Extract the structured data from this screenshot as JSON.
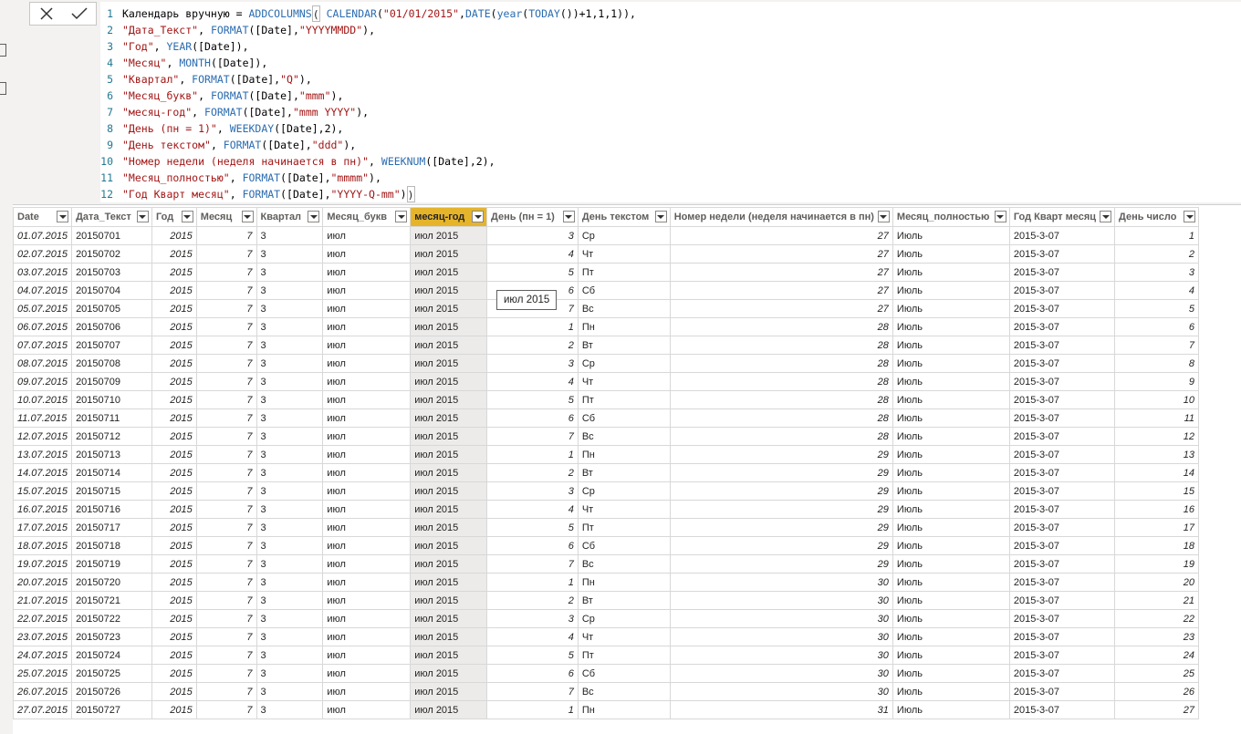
{
  "formula": {
    "lines": [
      [
        {
          "t": "Календарь вручную = ",
          "c": "plain"
        },
        {
          "t": "ADDCOLUMNS",
          "c": "fn"
        },
        {
          "t": "(",
          "c": "br"
        },
        {
          "t": " CALENDAR",
          "c": "fn"
        },
        {
          "t": "(",
          "c": "plain"
        },
        {
          "t": "\"01/01/2015\"",
          "c": "str"
        },
        {
          "t": ",",
          "c": "plain"
        },
        {
          "t": "DATE",
          "c": "fn"
        },
        {
          "t": "(",
          "c": "plain"
        },
        {
          "t": "year",
          "c": "fn"
        },
        {
          "t": "(",
          "c": "plain"
        },
        {
          "t": "TODAY",
          "c": "fn"
        },
        {
          "t": "())+1,1,1)),",
          "c": "plain"
        }
      ],
      [
        {
          "t": "\"Дата_Текст\"",
          "c": "str"
        },
        {
          "t": ", ",
          "c": "plain"
        },
        {
          "t": "FORMAT",
          "c": "fn"
        },
        {
          "t": "([Date],",
          "c": "plain"
        },
        {
          "t": "\"YYYYMMDD\"",
          "c": "str"
        },
        {
          "t": "),",
          "c": "plain"
        }
      ],
      [
        {
          "t": "\"Год\"",
          "c": "str"
        },
        {
          "t": ", ",
          "c": "plain"
        },
        {
          "t": "YEAR",
          "c": "fn"
        },
        {
          "t": "([Date]),",
          "c": "plain"
        }
      ],
      [
        {
          "t": "\"Месяц\"",
          "c": "str"
        },
        {
          "t": ", ",
          "c": "plain"
        },
        {
          "t": "MONTH",
          "c": "fn"
        },
        {
          "t": "([Date]),",
          "c": "plain"
        }
      ],
      [
        {
          "t": "\"Квартал\"",
          "c": "str"
        },
        {
          "t": ", ",
          "c": "plain"
        },
        {
          "t": "FORMAT",
          "c": "fn"
        },
        {
          "t": "([Date],",
          "c": "plain"
        },
        {
          "t": "\"Q\"",
          "c": "str"
        },
        {
          "t": "),",
          "c": "plain"
        }
      ],
      [
        {
          "t": "\"Месяц_букв\"",
          "c": "str"
        },
        {
          "t": ", ",
          "c": "plain"
        },
        {
          "t": "FORMAT",
          "c": "fn"
        },
        {
          "t": "([Date],",
          "c": "plain"
        },
        {
          "t": "\"mmm\"",
          "c": "str"
        },
        {
          "t": "),",
          "c": "plain"
        }
      ],
      [
        {
          "t": "\"месяц-год\"",
          "c": "str"
        },
        {
          "t": ", ",
          "c": "plain"
        },
        {
          "t": "FORMAT",
          "c": "fn"
        },
        {
          "t": "([Date],",
          "c": "plain"
        },
        {
          "t": "\"mmm YYYY\"",
          "c": "str"
        },
        {
          "t": "),",
          "c": "plain"
        }
      ],
      [
        {
          "t": "\"День (пн = 1)\"",
          "c": "str"
        },
        {
          "t": ", ",
          "c": "plain"
        },
        {
          "t": "WEEKDAY",
          "c": "fn"
        },
        {
          "t": "([Date],2),",
          "c": "plain"
        }
      ],
      [
        {
          "t": "\"День текстом\"",
          "c": "str"
        },
        {
          "t": ", ",
          "c": "plain"
        },
        {
          "t": "FORMAT",
          "c": "fn"
        },
        {
          "t": "([Date],",
          "c": "plain"
        },
        {
          "t": "\"ddd\"",
          "c": "str"
        },
        {
          "t": "),",
          "c": "plain"
        }
      ],
      [
        {
          "t": "\"Номер недели (неделя начинается в пн)\"",
          "c": "str"
        },
        {
          "t": ", ",
          "c": "plain"
        },
        {
          "t": "WEEKNUM",
          "c": "fn"
        },
        {
          "t": "([Date],2),",
          "c": "plain"
        }
      ],
      [
        {
          "t": "\"Месяц_полностью\"",
          "c": "str"
        },
        {
          "t": ", ",
          "c": "plain"
        },
        {
          "t": "FORMAT",
          "c": "fn"
        },
        {
          "t": "([Date],",
          "c": "plain"
        },
        {
          "t": "\"mmmm\"",
          "c": "str"
        },
        {
          "t": "),",
          "c": "plain"
        }
      ],
      [
        {
          "t": "\"Год Кварт месяц\"",
          "c": "str"
        },
        {
          "t": ", ",
          "c": "plain"
        },
        {
          "t": "FORMAT",
          "c": "fn"
        },
        {
          "t": "([Date],",
          "c": "plain"
        },
        {
          "t": "\"YYYY-Q-mm\"",
          "c": "str"
        },
        {
          "t": ")",
          "c": "plain"
        },
        {
          "t": ")",
          "c": "br"
        }
      ]
    ]
  },
  "table": {
    "columns": [
      {
        "label": "Date",
        "align": "date"
      },
      {
        "label": "Дата_Текст",
        "align": "text"
      },
      {
        "label": "Год",
        "align": "num"
      },
      {
        "label": "Месяц",
        "align": "num"
      },
      {
        "label": "Квартал",
        "align": "text"
      },
      {
        "label": "Месяц_букв",
        "align": "text"
      },
      {
        "label": "месяц-год",
        "align": "text",
        "selected": true
      },
      {
        "label": "День (пн = 1)",
        "align": "num"
      },
      {
        "label": "День текстом",
        "align": "text"
      },
      {
        "label": "Номер недели (неделя начинается в пн)",
        "align": "num"
      },
      {
        "label": "Месяц_полностью",
        "align": "text"
      },
      {
        "label": "Год Кварт месяц",
        "align": "text"
      },
      {
        "label": "День число",
        "align": "num"
      }
    ],
    "rows": [
      [
        "01.07.2015",
        "20150701",
        "2015",
        "7",
        "3",
        "июл",
        "июл 2015",
        "3",
        "Ср",
        "27",
        "Июль",
        "2015-3-07",
        "1"
      ],
      [
        "02.07.2015",
        "20150702",
        "2015",
        "7",
        "3",
        "июл",
        "июл 2015",
        "4",
        "Чт",
        "27",
        "Июль",
        "2015-3-07",
        "2"
      ],
      [
        "03.07.2015",
        "20150703",
        "2015",
        "7",
        "3",
        "июл",
        "июл 2015",
        "5",
        "Пт",
        "27",
        "Июль",
        "2015-3-07",
        "3"
      ],
      [
        "04.07.2015",
        "20150704",
        "2015",
        "7",
        "3",
        "июл",
        "июл 2015",
        "6",
        "Сб",
        "27",
        "Июль",
        "2015-3-07",
        "4"
      ],
      [
        "05.07.2015",
        "20150705",
        "2015",
        "7",
        "3",
        "июл",
        "июл 2015",
        "7",
        "Вс",
        "27",
        "Июль",
        "2015-3-07",
        "5"
      ],
      [
        "06.07.2015",
        "20150706",
        "2015",
        "7",
        "3",
        "июл",
        "июл 2015",
        "1",
        "Пн",
        "28",
        "Июль",
        "2015-3-07",
        "6"
      ],
      [
        "07.07.2015",
        "20150707",
        "2015",
        "7",
        "3",
        "июл",
        "июл 2015",
        "2",
        "Вт",
        "28",
        "Июль",
        "2015-3-07",
        "7"
      ],
      [
        "08.07.2015",
        "20150708",
        "2015",
        "7",
        "3",
        "июл",
        "июл 2015",
        "3",
        "Ср",
        "28",
        "Июль",
        "2015-3-07",
        "8"
      ],
      [
        "09.07.2015",
        "20150709",
        "2015",
        "7",
        "3",
        "июл",
        "июл 2015",
        "4",
        "Чт",
        "28",
        "Июль",
        "2015-3-07",
        "9"
      ],
      [
        "10.07.2015",
        "20150710",
        "2015",
        "7",
        "3",
        "июл",
        "июл 2015",
        "5",
        "Пт",
        "28",
        "Июль",
        "2015-3-07",
        "10"
      ],
      [
        "11.07.2015",
        "20150711",
        "2015",
        "7",
        "3",
        "июл",
        "июл 2015",
        "6",
        "Сб",
        "28",
        "Июль",
        "2015-3-07",
        "11"
      ],
      [
        "12.07.2015",
        "20150712",
        "2015",
        "7",
        "3",
        "июл",
        "июл 2015",
        "7",
        "Вс",
        "28",
        "Июль",
        "2015-3-07",
        "12"
      ],
      [
        "13.07.2015",
        "20150713",
        "2015",
        "7",
        "3",
        "июл",
        "июл 2015",
        "1",
        "Пн",
        "29",
        "Июль",
        "2015-3-07",
        "13"
      ],
      [
        "14.07.2015",
        "20150714",
        "2015",
        "7",
        "3",
        "июл",
        "июл 2015",
        "2",
        "Вт",
        "29",
        "Июль",
        "2015-3-07",
        "14"
      ],
      [
        "15.07.2015",
        "20150715",
        "2015",
        "7",
        "3",
        "июл",
        "июл 2015",
        "3",
        "Ср",
        "29",
        "Июль",
        "2015-3-07",
        "15"
      ],
      [
        "16.07.2015",
        "20150716",
        "2015",
        "7",
        "3",
        "июл",
        "июл 2015",
        "4",
        "Чт",
        "29",
        "Июль",
        "2015-3-07",
        "16"
      ],
      [
        "17.07.2015",
        "20150717",
        "2015",
        "7",
        "3",
        "июл",
        "июл 2015",
        "5",
        "Пт",
        "29",
        "Июль",
        "2015-3-07",
        "17"
      ],
      [
        "18.07.2015",
        "20150718",
        "2015",
        "7",
        "3",
        "июл",
        "июл 2015",
        "6",
        "Сб",
        "29",
        "Июль",
        "2015-3-07",
        "18"
      ],
      [
        "19.07.2015",
        "20150719",
        "2015",
        "7",
        "3",
        "июл",
        "июл 2015",
        "7",
        "Вс",
        "29",
        "Июль",
        "2015-3-07",
        "19"
      ],
      [
        "20.07.2015",
        "20150720",
        "2015",
        "7",
        "3",
        "июл",
        "июл 2015",
        "1",
        "Пн",
        "30",
        "Июль",
        "2015-3-07",
        "20"
      ],
      [
        "21.07.2015",
        "20150721",
        "2015",
        "7",
        "3",
        "июл",
        "июл 2015",
        "2",
        "Вт",
        "30",
        "Июль",
        "2015-3-07",
        "21"
      ],
      [
        "22.07.2015",
        "20150722",
        "2015",
        "7",
        "3",
        "июл",
        "июл 2015",
        "3",
        "Ср",
        "30",
        "Июль",
        "2015-3-07",
        "22"
      ],
      [
        "23.07.2015",
        "20150723",
        "2015",
        "7",
        "3",
        "июл",
        "июл 2015",
        "4",
        "Чт",
        "30",
        "Июль",
        "2015-3-07",
        "23"
      ],
      [
        "24.07.2015",
        "20150724",
        "2015",
        "7",
        "3",
        "июл",
        "июл 2015",
        "5",
        "Пт",
        "30",
        "Июль",
        "2015-3-07",
        "24"
      ],
      [
        "25.07.2015",
        "20150725",
        "2015",
        "7",
        "3",
        "июл",
        "июл 2015",
        "6",
        "Сб",
        "30",
        "Июль",
        "2015-3-07",
        "25"
      ],
      [
        "26.07.2015",
        "20150726",
        "2015",
        "7",
        "3",
        "июл",
        "июл 2015",
        "7",
        "Вс",
        "30",
        "Июль",
        "2015-3-07",
        "26"
      ],
      [
        "27.07.2015",
        "20150727",
        "2015",
        "7",
        "3",
        "июл",
        "июл 2015",
        "1",
        "Пн",
        "31",
        "Июль",
        "2015-3-07",
        "27"
      ]
    ]
  },
  "tooltip": "июл 2015",
  "colors": {
    "selected_header": "#e5b42b",
    "selected_column": "#ecebea"
  },
  "icons": {
    "cancel": "close-icon",
    "commit": "checkmark-icon"
  }
}
